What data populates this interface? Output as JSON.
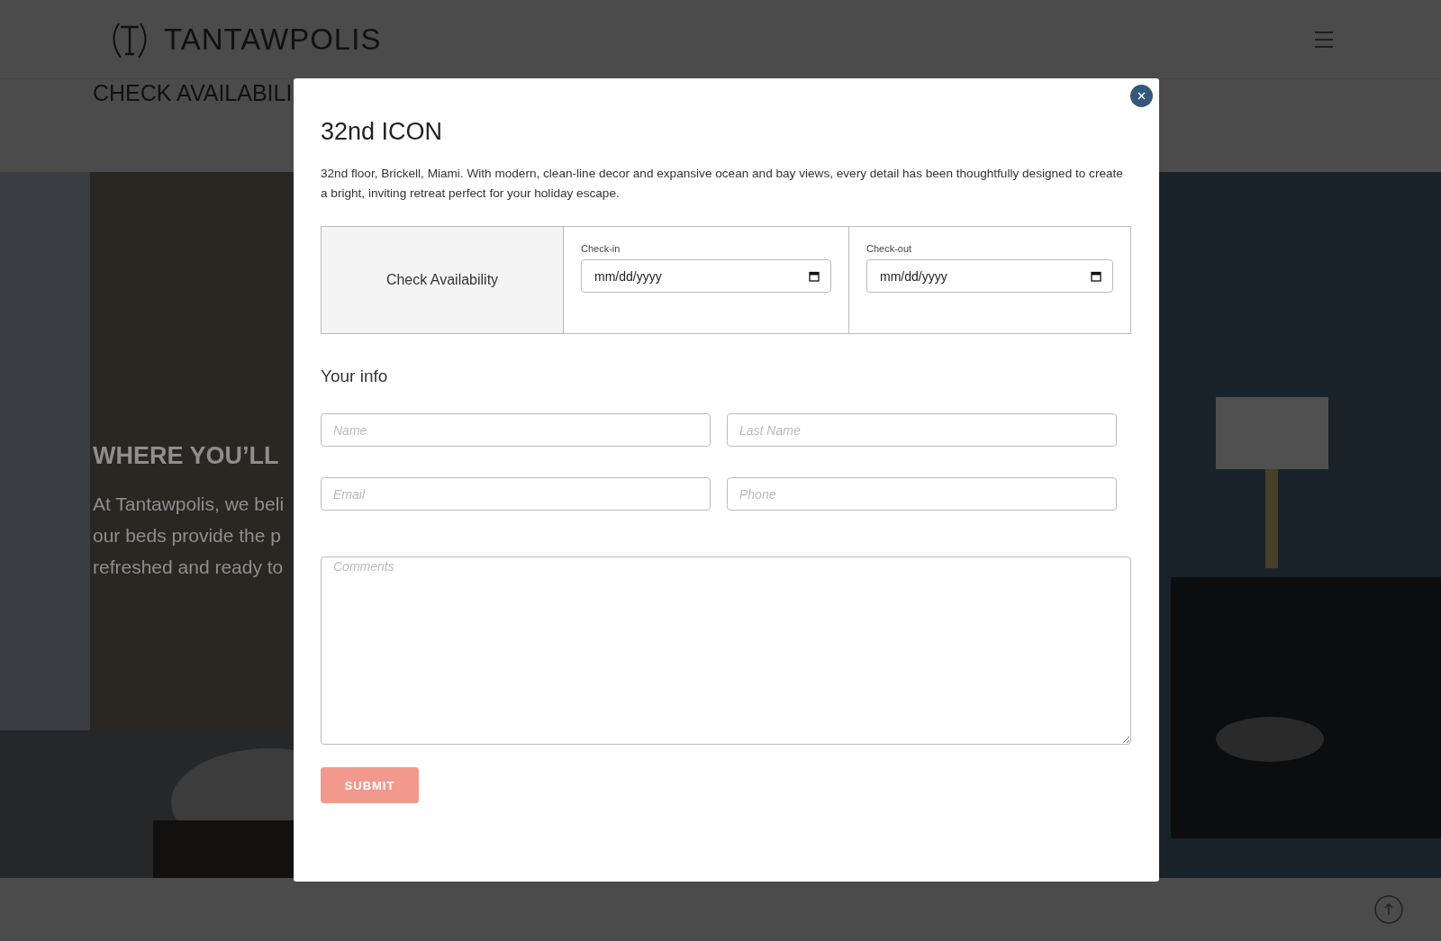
{
  "header": {
    "brand": "TANTAWPOLIS"
  },
  "page_heading": "CHECK AVAILABILI",
  "hero": {
    "kind": "picture",
    "heading": "WHERE YOU’LL",
    "lines": [
      "At Tantawpolis, we beli",
      "our beds provide the p",
      "refreshed and ready to"
    ]
  },
  "modal": {
    "title": "32nd ICON",
    "description": "32nd floor, Brickell, Miami. With modern, clean-line decor and expansive ocean and bay views, every detail has been thoughtfully designed to create a bright, inviting retreat perfect for your holiday escape.",
    "availability": {
      "label": "Check Availability",
      "fields": [
        {
          "label": "Check-in",
          "placeholder": "mm/dd/yyyy"
        },
        {
          "label": "Check-out",
          "placeholder": "mm/dd/yyyy"
        }
      ]
    },
    "section_title": "Your info",
    "fields": [
      {
        "placeholder": "Name"
      },
      {
        "placeholder": "Last Name"
      },
      {
        "placeholder": "Email"
      },
      {
        "placeholder": "Phone"
      }
    ],
    "comments": {
      "placeholder": "Comments"
    },
    "submit": "SUBMIT"
  }
}
